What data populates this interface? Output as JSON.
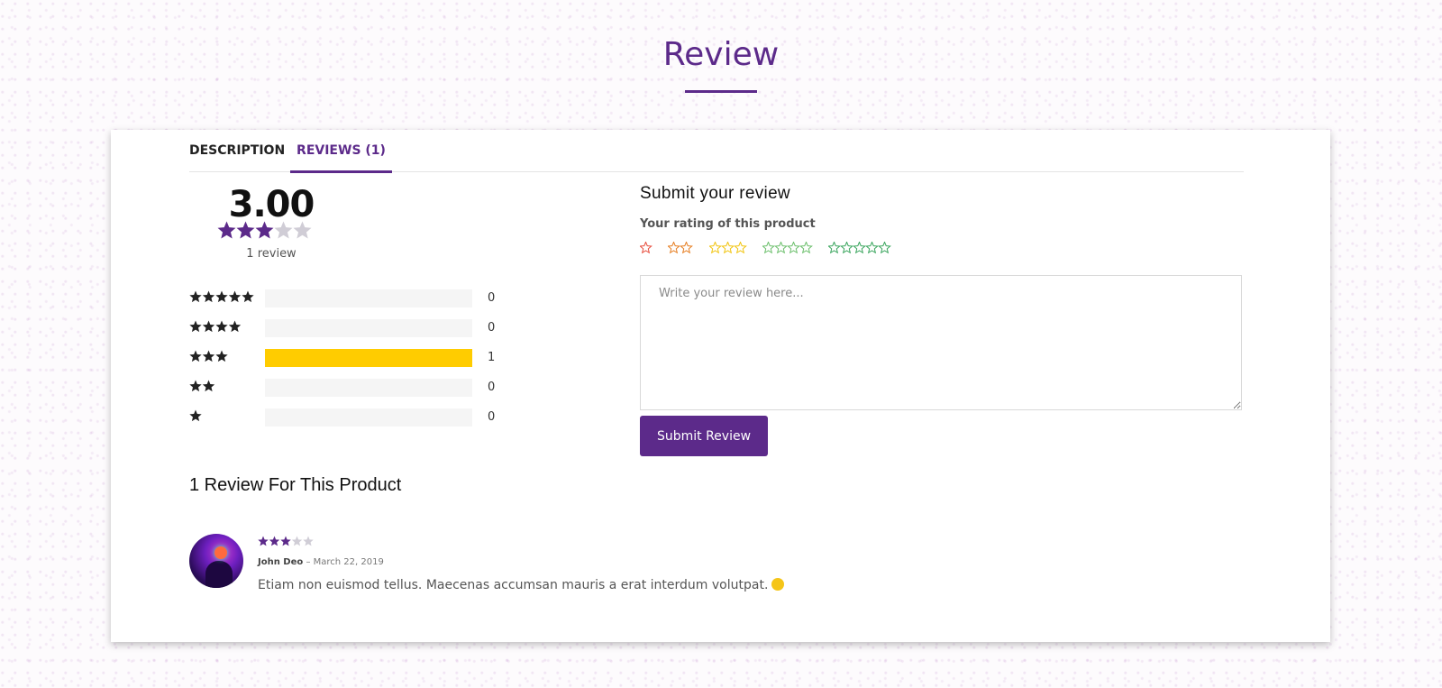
{
  "page": {
    "title": "Review"
  },
  "tabs": [
    {
      "label": "DESCRIPTION",
      "active": false
    },
    {
      "label": "REVIEWS (1)",
      "active": true
    }
  ],
  "summary": {
    "average": "3.00",
    "average_stars": 3,
    "max_stars": 5,
    "count_label": "1 review",
    "breakdown": [
      {
        "stars": 5,
        "count": "0",
        "fraction": 0
      },
      {
        "stars": 4,
        "count": "0",
        "fraction": 0
      },
      {
        "stars": 3,
        "count": "1",
        "fraction": 1
      },
      {
        "stars": 2,
        "count": "0",
        "fraction": 0
      },
      {
        "stars": 1,
        "count": "0",
        "fraction": 0
      }
    ]
  },
  "form": {
    "heading": "Submit your review",
    "rating_label": "Your rating of this product",
    "rating_options": [
      {
        "stars": 1,
        "color": "#e74c3c"
      },
      {
        "stars": 2,
        "color": "#e67e22"
      },
      {
        "stars": 3,
        "color": "#f1c40f"
      },
      {
        "stars": 4,
        "color": "#6cbf6c"
      },
      {
        "stars": 5,
        "color": "#3aa55d"
      }
    ],
    "placeholder": "Write your review here...",
    "submit_label": "Submit Review"
  },
  "reviews_list": {
    "heading": "1 Review For This Product",
    "items": [
      {
        "rating": 3,
        "author": "John Deo",
        "separator": " – ",
        "date": "March 22, 2019",
        "text": "Etiam non euismod tellus. Maecenas accumsan mauris a erat interdum volutpat."
      }
    ]
  },
  "colors": {
    "accent": "#5c2a8a",
    "bar_fill": "#ffcc00",
    "star_empty": "#d0cdd6",
    "star_dark": "#222222"
  },
  "icons": {
    "star": "star-icon",
    "emoji": "grinning-face-icon"
  }
}
